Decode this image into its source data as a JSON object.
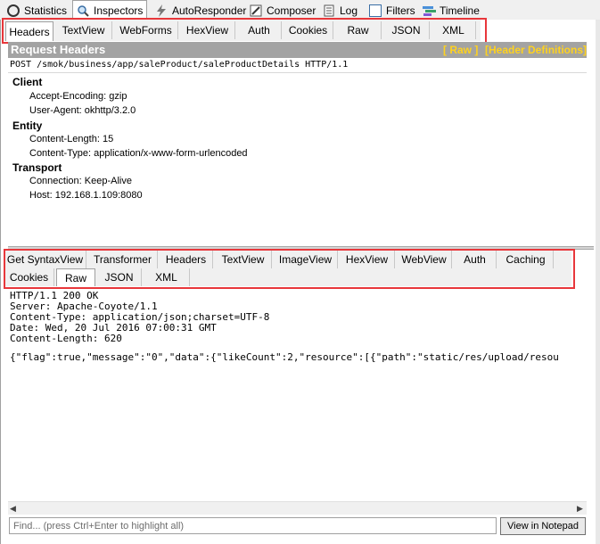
{
  "top_tabs": [
    {
      "label": "Statistics",
      "icon": "stopwatch-icon"
    },
    {
      "label": "Inspectors",
      "icon": "magnifier-icon"
    },
    {
      "label": "AutoResponder",
      "icon": "lightning-icon"
    },
    {
      "label": "Composer",
      "icon": "pencil-icon"
    },
    {
      "label": "Log",
      "icon": "log-icon"
    },
    {
      "label": "Filters",
      "icon": "checkbox-icon"
    },
    {
      "label": "Timeline",
      "icon": "timeline-icon"
    }
  ],
  "request": {
    "tabs": [
      "Headers",
      "TextView",
      "WebForms",
      "HexView",
      "Auth",
      "Cookies",
      "Raw",
      "JSON",
      "XML"
    ],
    "active_tab": "Headers",
    "title": "Request Headers",
    "raw_link": "[ Raw ]",
    "defs_link": "[Header Definitions]",
    "request_line": "POST /smok/business/app/saleProduct/saleProductDetails HTTP/1.1",
    "groups": [
      {
        "name": "Client",
        "headers": [
          "Accept-Encoding: gzip",
          "User-Agent: okhttp/3.2.0"
        ]
      },
      {
        "name": "Entity",
        "headers": [
          "Content-Length: 15",
          "Content-Type: application/x-www-form-urlencoded"
        ]
      },
      {
        "name": "Transport",
        "headers": [
          "Connection: Keep-Alive",
          "Host: 192.168.1.109:8080"
        ]
      }
    ]
  },
  "response": {
    "tabs_row1": [
      "Get SyntaxView",
      "Transformer",
      "Headers",
      "TextView",
      "ImageView",
      "HexView",
      "WebView",
      "Auth",
      "Caching"
    ],
    "tabs_row2": [
      "Cookies",
      "Raw",
      "JSON",
      "XML"
    ],
    "active_tab": "Raw",
    "raw_lines": [
      "HTTP/1.1 200 OK",
      "Server: Apache-Coyote/1.1",
      "Content-Type: application/json;charset=UTF-8",
      "Date: Wed, 20 Jul 2016 07:00:31 GMT",
      "Content-Length: 620"
    ],
    "body": "{\"flag\":true,\"message\":\"0\",\"data\":{\"likeCount\":2,\"resource\":[{\"path\":\"static/res/upload/resou"
  },
  "find": {
    "placeholder": "Find... (press Ctrl+Enter to highlight all)",
    "button": "View in Notepad"
  },
  "colors": {
    "highlight_border": "#e8373b",
    "title_bar": "#a3a3a3",
    "link": "#ffd21e"
  }
}
